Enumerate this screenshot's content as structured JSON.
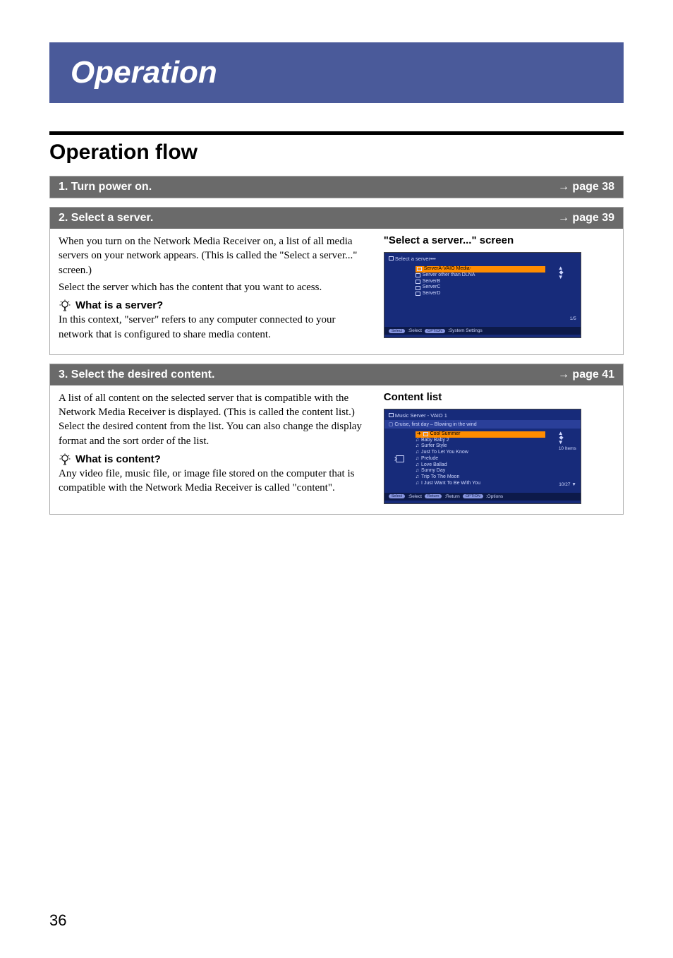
{
  "page_number": "36",
  "chapter_title": "Operation",
  "flow_heading": "Operation flow",
  "steps": [
    {
      "num_label": "1.  Turn power on.",
      "page_ref": "→ page 38"
    },
    {
      "num_label": "2. Select a server.",
      "page_ref": "→ page 39",
      "para1": "When you turn on the Network Media Receiver on, a list of all media servers on your network appears. (This is called the \"Select a server...\" screen.)",
      "para2": "Select the server which has the content that you want to acess.",
      "tip_title": "What is a server?",
      "tip_body": "In this context, \"server\" refers to any computer connected to your network that is configured to share media content.",
      "side_title": "\"Select a server...\" screen",
      "screen": {
        "header": "Select a server•••",
        "items": [
          "ServerA-VAIO Media-",
          "Server other than DLNA",
          "ServerB",
          "ServerC",
          "ServerD"
        ],
        "counter": "1/5",
        "footer_select_pill": "Select",
        "footer_select_label": ":Select",
        "footer_option_pill": "OPTION",
        "footer_option_label": ":System Settings"
      }
    },
    {
      "num_label": "3. Select the desired content.",
      "page_ref": "→ page 41",
      "para1": "A list of all content on the selected server that is compatible with the Network Media Receiver is displayed. (This is called the content list.) Select the desired content from the list. You can also change the display format and the sort order of the list.",
      "tip_title": "What is content?",
      "tip_body": "Any video file, music file, or image file stored on the computer that is compatible with the Network Media Receiver is called \"content\".",
      "side_title": "Content list",
      "screen": {
        "header": "Music Server - VAIO 1",
        "subheader": "Cruise, first day – Blowing in the wind",
        "items": [
          "Cool Summer",
          "Baby Baby 2",
          "Surfer Style",
          "Just To Let You Know",
          "Prelude",
          "Love Ballad",
          "Sunny Day",
          "Trip To The Moon",
          "I Just Want To Be With You"
        ],
        "items_count": "10 Items",
        "counter": "10/27",
        "footer_select_pill": "Select",
        "footer_select_label": ":Select",
        "footer_return_pill": "Return",
        "footer_return_label": ":Return",
        "footer_option_pill": "OPTION",
        "footer_option_label": ":Options"
      }
    }
  ]
}
